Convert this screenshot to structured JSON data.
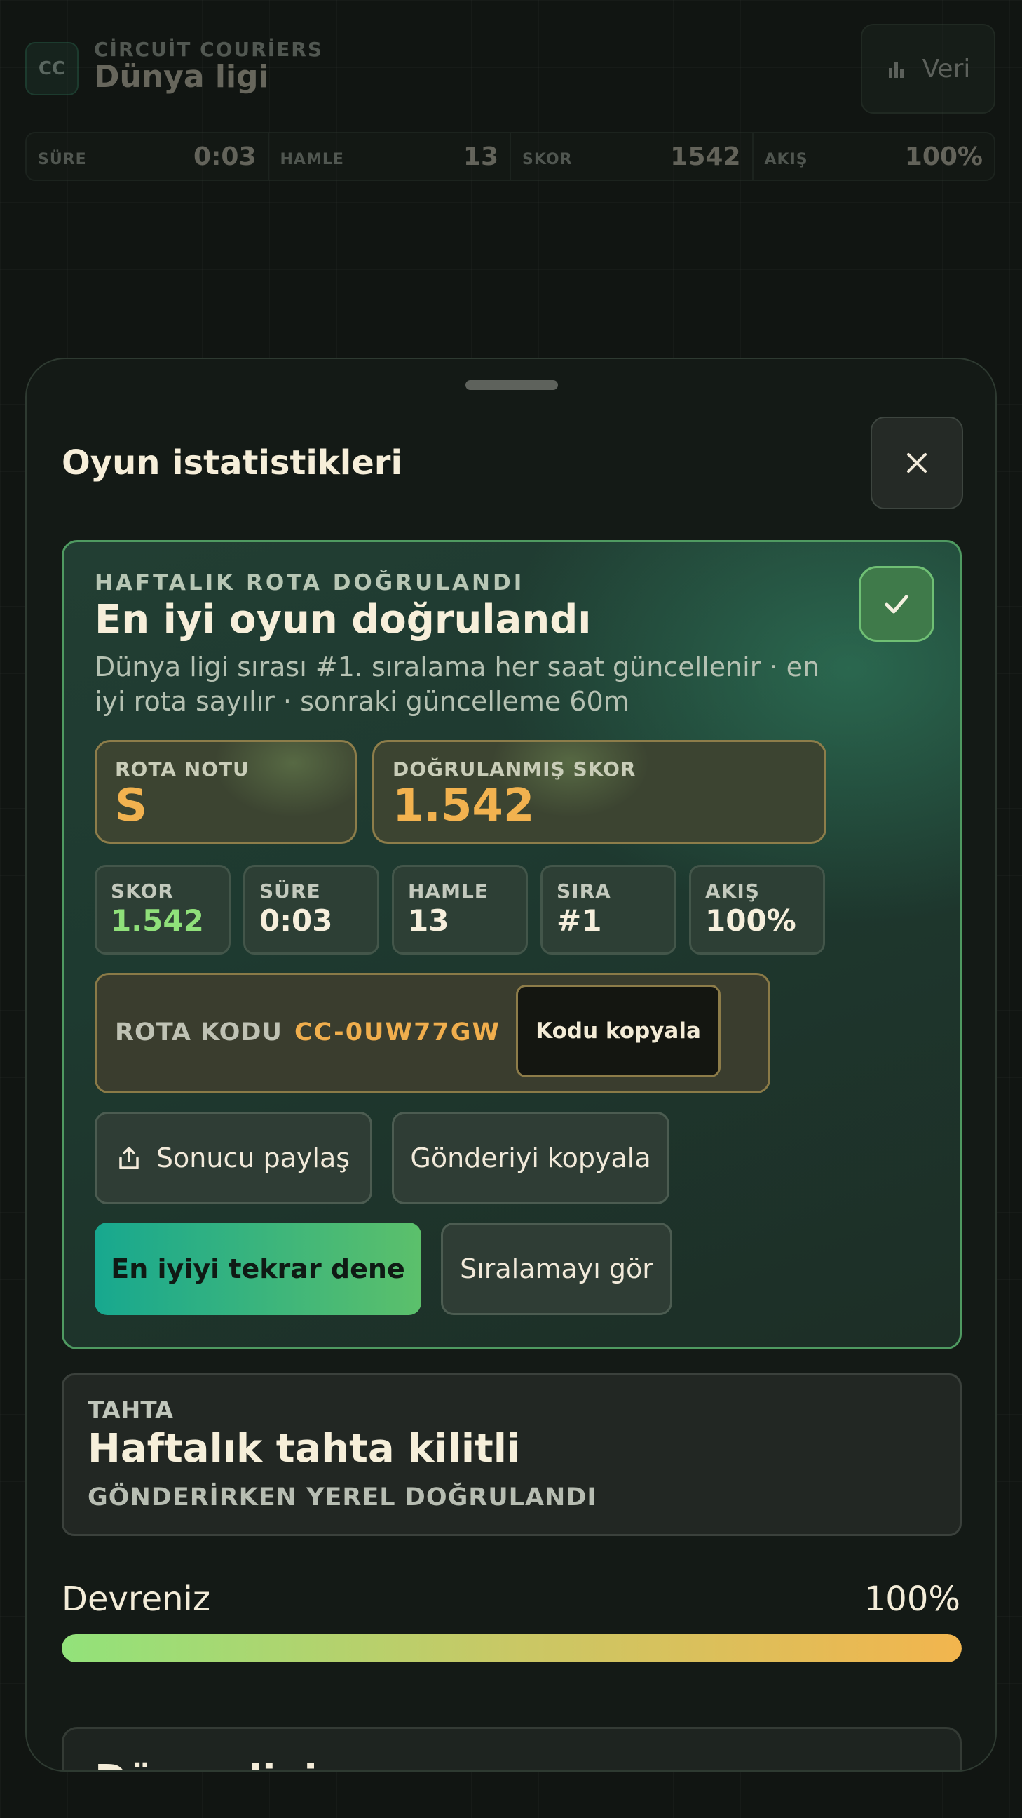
{
  "header": {
    "logo_text": "CC",
    "brand_kicker": "CİRCUİT COURİERS",
    "brand_title": "Dünya ligi",
    "data_button": {
      "label": "Veri",
      "icon": "bar-chart-icon"
    }
  },
  "top_stats": [
    {
      "label": "SÜRE",
      "value": "0:03"
    },
    {
      "label": "HAMLE",
      "value": "13"
    },
    {
      "label": "SKOR",
      "value": "1542"
    },
    {
      "label": "AKIŞ",
      "value": "100%"
    }
  ],
  "sheet": {
    "title": "Oyun istatistikleri",
    "close_icon": "close-icon"
  },
  "verified": {
    "kicker": "HAFTALIK ROTA DOĞRULANDI",
    "title": "En iyi oyun doğrulandı",
    "subtitle": "Dünya ligi sırası #1. sıralama her saat güncellenir · en iyi rota sayılır · sonraki güncelleme 60m",
    "grade": {
      "label": "ROTA NOTU",
      "value": "S"
    },
    "verified_score": {
      "label": "DOĞRULANMIŞ SKOR",
      "value": "1.542"
    },
    "stats": [
      {
        "label": "SKOR",
        "value": "1.542"
      },
      {
        "label": "SÜRE",
        "value": "0:03"
      },
      {
        "label": "HAMLE",
        "value": "13"
      },
      {
        "label": "SIRA",
        "value": "#1"
      },
      {
        "label": "AKIŞ",
        "value": "100%"
      }
    ],
    "route_code": {
      "label": "ROTA KODU",
      "value": "CC-0UW77GW",
      "copy_label": "Kodu kopyala"
    },
    "share_label": "Sonucu paylaş",
    "copy_post_label": "Gönderiyi kopyala",
    "retry_label": "En iyiyi tekrar dene",
    "leaderboard_label": "Sıralamayı gör"
  },
  "board": {
    "kicker": "TAHTA",
    "title": "Haftalık tahta kilitli",
    "status": "GÖNDERİRKEN YEREL DOĞRULANDI"
  },
  "progress": {
    "label": "Devreniz",
    "value_text": "100%",
    "fraction": 1.0
  },
  "next_card": {
    "title": "Dünya ligi sırası"
  },
  "colors": {
    "accent_gold": "#f2b24f",
    "accent_green": "#8fe07a",
    "primary_gradient_start": "#17a88f",
    "primary_gradient_end": "#5cc06b"
  }
}
